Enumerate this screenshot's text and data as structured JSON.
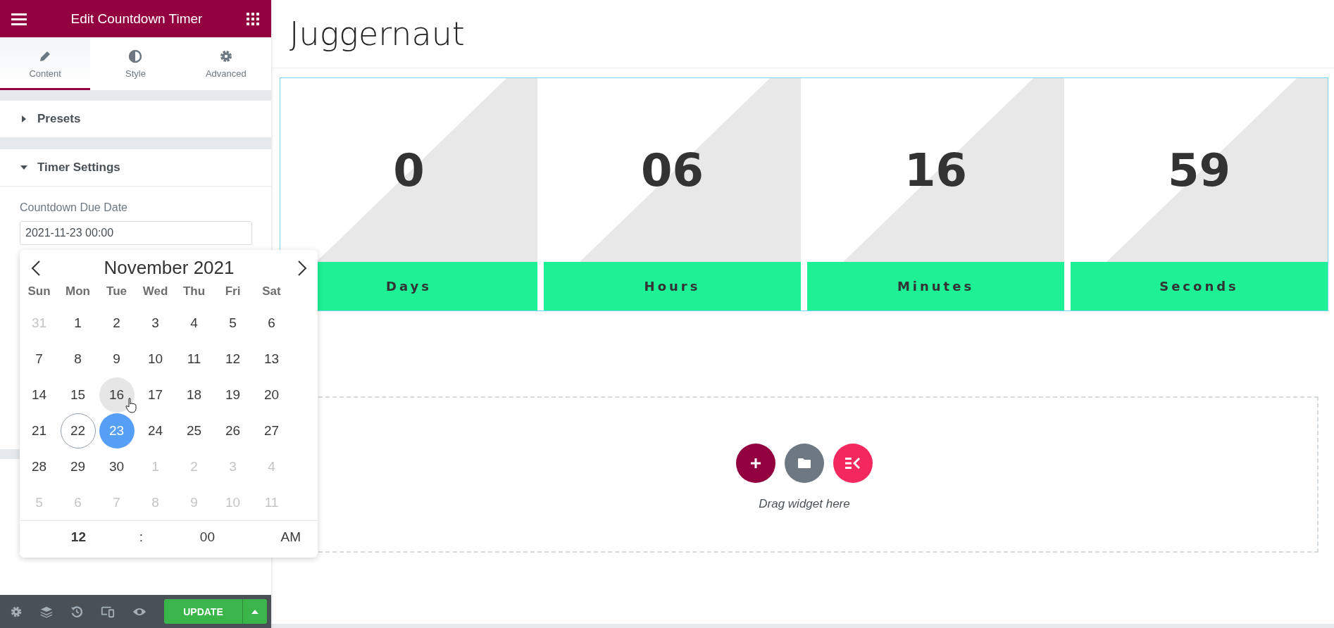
{
  "panel": {
    "title": "Edit Countdown Timer",
    "tabs": [
      {
        "label": "Content",
        "selected": true
      },
      {
        "label": "Style",
        "selected": false
      },
      {
        "label": "Advanced",
        "selected": false
      }
    ],
    "sections": [
      {
        "title": "Presets",
        "expanded": false
      },
      {
        "title": "Timer Settings",
        "expanded": true
      }
    ],
    "field": {
      "label": "Countdown Due Date",
      "value": "2021-11-23 00:00"
    },
    "update_button": "UPDATE"
  },
  "datepicker": {
    "month": "November 2021",
    "weekdays": [
      "Sun",
      "Mon",
      "Tue",
      "Wed",
      "Thu",
      "Fri",
      "Sat"
    ],
    "days": [
      {
        "day": "31",
        "other_month": true,
        "selected": false,
        "today": false,
        "hovered": false
      },
      {
        "day": "1",
        "other_month": false,
        "selected": false,
        "today": false,
        "hovered": false
      },
      {
        "day": "2",
        "other_month": false,
        "selected": false,
        "today": false,
        "hovered": false
      },
      {
        "day": "3",
        "other_month": false,
        "selected": false,
        "today": false,
        "hovered": false
      },
      {
        "day": "4",
        "other_month": false,
        "selected": false,
        "today": false,
        "hovered": false
      },
      {
        "day": "5",
        "other_month": false,
        "selected": false,
        "today": false,
        "hovered": false
      },
      {
        "day": "6",
        "other_month": false,
        "selected": false,
        "today": false,
        "hovered": false
      },
      {
        "day": "7",
        "other_month": false,
        "selected": false,
        "today": false,
        "hovered": false
      },
      {
        "day": "8",
        "other_month": false,
        "selected": false,
        "today": false,
        "hovered": false
      },
      {
        "day": "9",
        "other_month": false,
        "selected": false,
        "today": false,
        "hovered": false
      },
      {
        "day": "10",
        "other_month": false,
        "selected": false,
        "today": false,
        "hovered": false
      },
      {
        "day": "11",
        "other_month": false,
        "selected": false,
        "today": false,
        "hovered": false
      },
      {
        "day": "12",
        "other_month": false,
        "selected": false,
        "today": false,
        "hovered": false
      },
      {
        "day": "13",
        "other_month": false,
        "selected": false,
        "today": false,
        "hovered": false
      },
      {
        "day": "14",
        "other_month": false,
        "selected": false,
        "today": false,
        "hovered": false
      },
      {
        "day": "15",
        "other_month": false,
        "selected": false,
        "today": false,
        "hovered": false
      },
      {
        "day": "16",
        "other_month": false,
        "selected": false,
        "today": false,
        "hovered": true
      },
      {
        "day": "17",
        "other_month": false,
        "selected": false,
        "today": false,
        "hovered": false
      },
      {
        "day": "18",
        "other_month": false,
        "selected": false,
        "today": false,
        "hovered": false
      },
      {
        "day": "19",
        "other_month": false,
        "selected": false,
        "today": false,
        "hovered": false
      },
      {
        "day": "20",
        "other_month": false,
        "selected": false,
        "today": false,
        "hovered": false
      },
      {
        "day": "21",
        "other_month": false,
        "selected": false,
        "today": false,
        "hovered": false
      },
      {
        "day": "22",
        "other_month": false,
        "selected": false,
        "today": true,
        "hovered": false
      },
      {
        "day": "23",
        "other_month": false,
        "selected": true,
        "today": false,
        "hovered": false
      },
      {
        "day": "24",
        "other_month": false,
        "selected": false,
        "today": false,
        "hovered": false
      },
      {
        "day": "25",
        "other_month": false,
        "selected": false,
        "today": false,
        "hovered": false
      },
      {
        "day": "26",
        "other_month": false,
        "selected": false,
        "today": false,
        "hovered": false
      },
      {
        "day": "27",
        "other_month": false,
        "selected": false,
        "today": false,
        "hovered": false
      },
      {
        "day": "28",
        "other_month": false,
        "selected": false,
        "today": false,
        "hovered": false
      },
      {
        "day": "29",
        "other_month": false,
        "selected": false,
        "today": false,
        "hovered": false
      },
      {
        "day": "30",
        "other_month": false,
        "selected": false,
        "today": false,
        "hovered": false
      },
      {
        "day": "1",
        "other_month": true,
        "selected": false,
        "today": false,
        "hovered": false
      },
      {
        "day": "2",
        "other_month": true,
        "selected": false,
        "today": false,
        "hovered": false
      },
      {
        "day": "3",
        "other_month": true,
        "selected": false,
        "today": false,
        "hovered": false
      },
      {
        "day": "4",
        "other_month": true,
        "selected": false,
        "today": false,
        "hovered": false
      },
      {
        "day": "5",
        "other_month": true,
        "selected": false,
        "today": false,
        "hovered": false
      },
      {
        "day": "6",
        "other_month": true,
        "selected": false,
        "today": false,
        "hovered": false
      },
      {
        "day": "7",
        "other_month": true,
        "selected": false,
        "today": false,
        "hovered": false
      },
      {
        "day": "8",
        "other_month": true,
        "selected": false,
        "today": false,
        "hovered": false
      },
      {
        "day": "9",
        "other_month": true,
        "selected": false,
        "today": false,
        "hovered": false
      },
      {
        "day": "10",
        "other_month": true,
        "selected": false,
        "today": false,
        "hovered": false
      },
      {
        "day": "11",
        "other_month": true,
        "selected": false,
        "today": false,
        "hovered": false
      }
    ],
    "time": {
      "hour": "12",
      "separator": ":",
      "minute": "00",
      "period": "AM"
    }
  },
  "page": {
    "title": "Juggernaut",
    "countdown": [
      {
        "value": "0",
        "label": "Days"
      },
      {
        "value": "06",
        "label": "Hours"
      },
      {
        "value": "16",
        "label": "Minutes"
      },
      {
        "value": "59",
        "label": "Seconds"
      }
    ],
    "drop_zone": {
      "hint": "Drag widget here"
    }
  }
}
